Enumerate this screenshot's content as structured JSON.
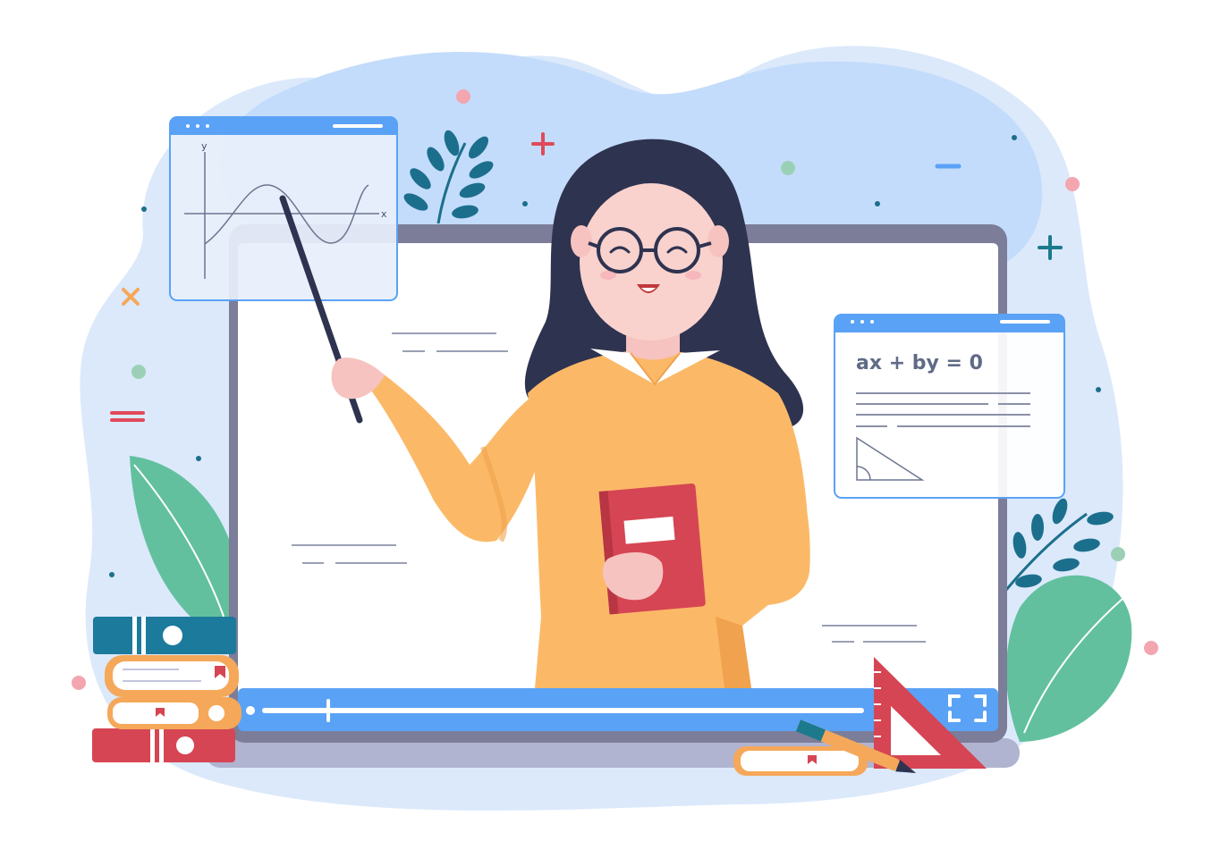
{
  "graph_panel": {
    "y_axis_label": "y",
    "x_axis_label": "x"
  },
  "equation_panel": {
    "equation": "ax + by = 0"
  },
  "video_player": {
    "progress": 0.11
  },
  "colors": {
    "blob_light": "#dbe9fb",
    "blob_mid": "#c4dcfb",
    "screen_frame": "#7b7d99",
    "player_bar": "#5aa2f6",
    "sweater": "#fbb968",
    "hair": "#2e3350",
    "book_red": "#d64553",
    "leaf_green": "#62c09e",
    "leaf_teal": "#1c6f8c"
  }
}
